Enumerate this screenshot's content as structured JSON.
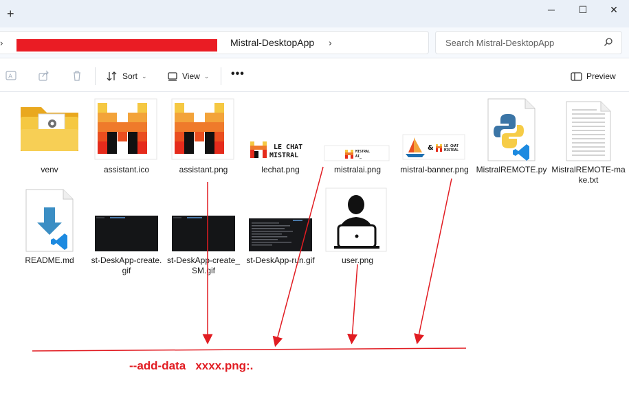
{
  "titlebar": {
    "new_tab": "+",
    "minimize": "─",
    "maximize": "☐",
    "close": "✕"
  },
  "address": {
    "breadcrumb_current": "Mistral-DesktopApp",
    "search_placeholder": "Search Mistral-DesktopApp"
  },
  "toolbar": {
    "sort_label": "Sort",
    "view_label": "View",
    "more_label": "•••",
    "preview_label": "Preview"
  },
  "files": [
    {
      "name": "venv",
      "icon": "folder-icon"
    },
    {
      "name": "assistant.ico",
      "icon": "mistral-logo-thumb"
    },
    {
      "name": "assistant.png",
      "icon": "mistral-logo-thumb"
    },
    {
      "name": "lechat.png",
      "icon": "lechat-thumb"
    },
    {
      "name": "mistralai.png",
      "icon": "mistralai-thumb"
    },
    {
      "name": "mistral-banner.png",
      "icon": "banner-thumb"
    },
    {
      "name": "MistralREMOTE.py",
      "icon": "python-file-icon"
    },
    {
      "name": "MistralREMOTE-make.txt",
      "icon": "text-file-icon"
    },
    {
      "name": "README.md",
      "icon": "markdown-file-icon"
    },
    {
      "name": "st-DeskApp-create.gif",
      "icon": "gif-thumb"
    },
    {
      "name": "st-DeskApp-create_SM.gif",
      "icon": "gif-thumb"
    },
    {
      "name": "st-DeskApp-run.gif",
      "icon": "gif-thumb"
    },
    {
      "name": "user.png",
      "icon": "user-thumb"
    }
  ],
  "thumb_text": {
    "lechat_line1": "LE CHAT",
    "lechat_line2": "MISTRAL",
    "mistralai_line1": "MISTRAL",
    "mistralai_line2": "AI_",
    "banner_amp": "&",
    "banner_line1": "LE CHAT",
    "banner_line2": "MISTRAL"
  },
  "annotation": {
    "text": "--add-data   xxxx.png:.",
    "color": "#e11c22"
  },
  "colors": {
    "redaction": "#ea1c24",
    "accent_blue": "#0a6ed1",
    "folder_yellow": "#f5c842"
  }
}
